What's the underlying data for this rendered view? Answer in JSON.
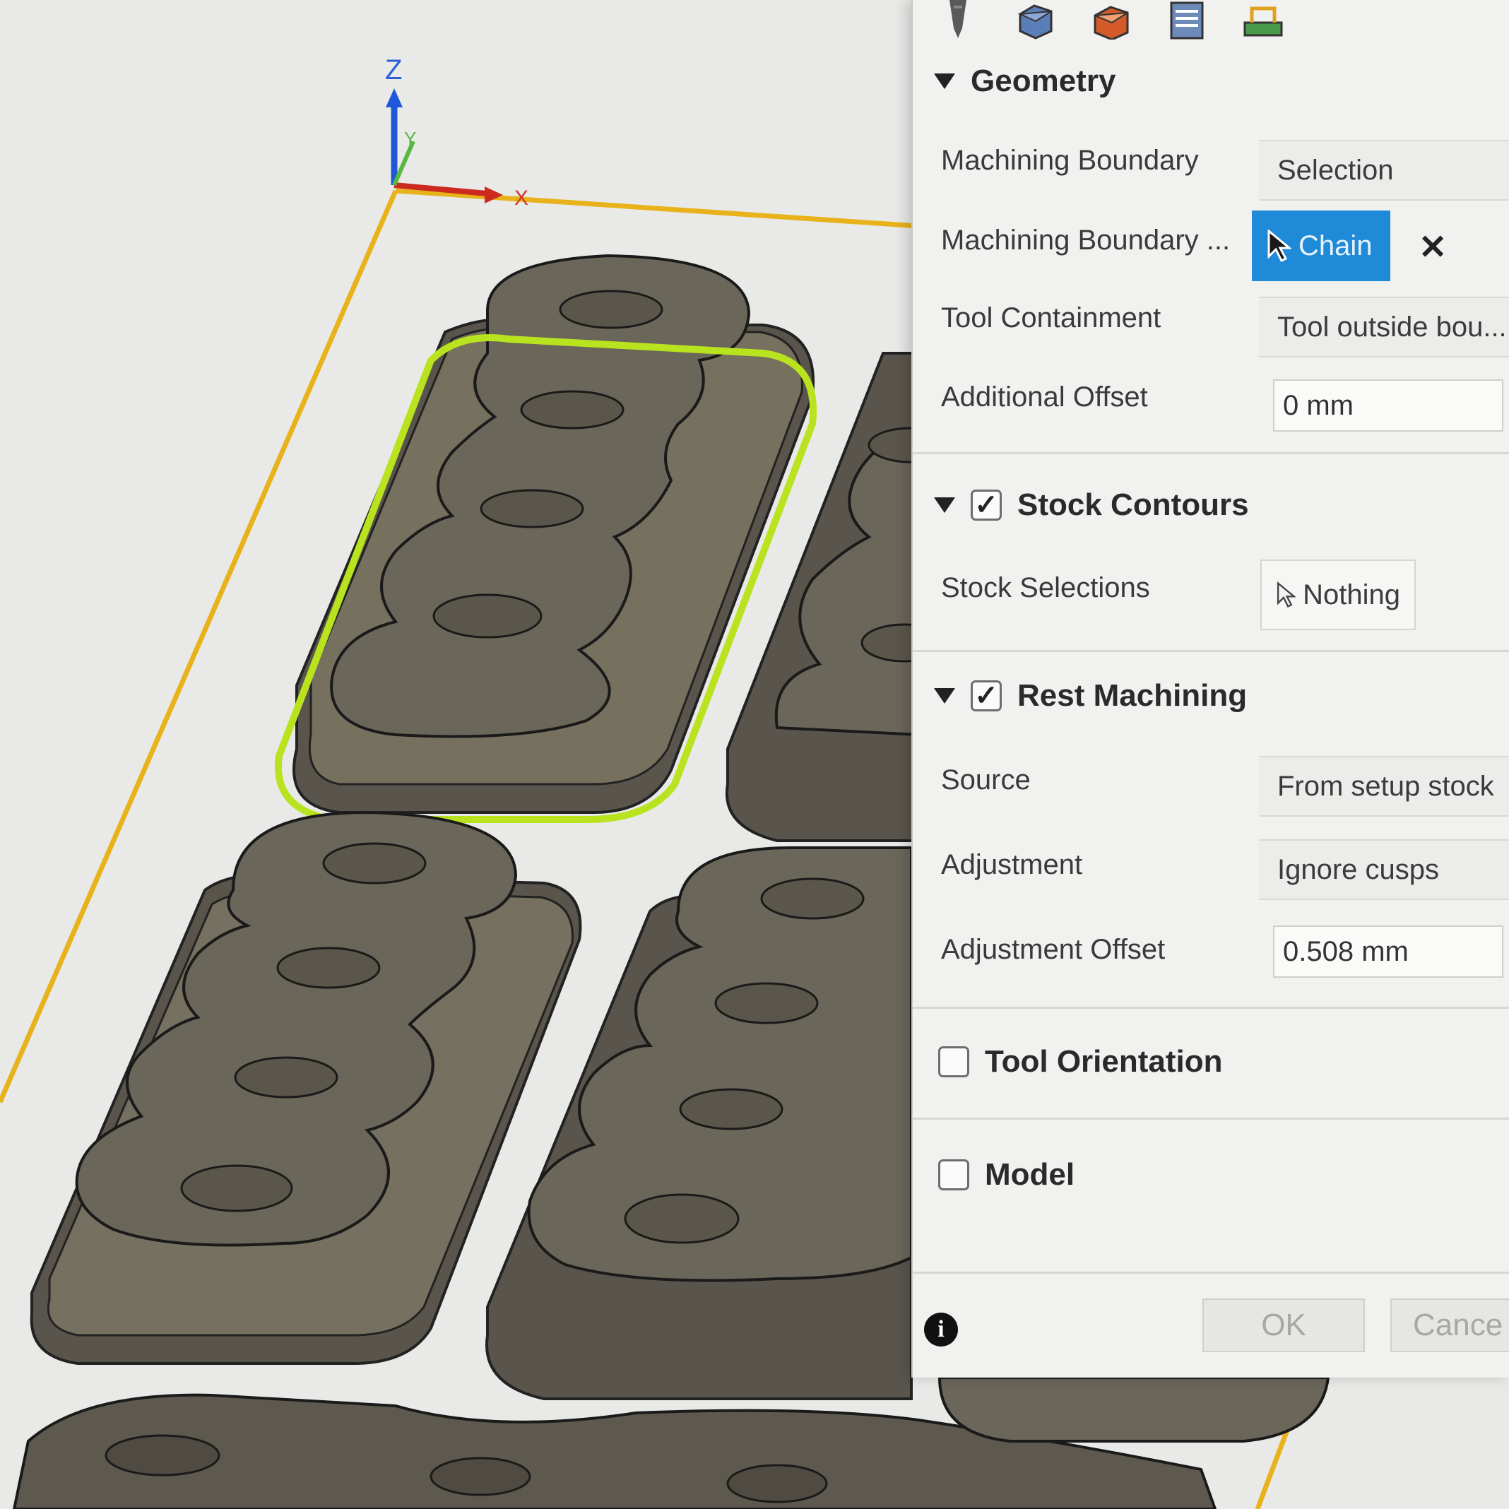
{
  "viewport": {
    "axes": {
      "z_label": "Z",
      "x_label": "X",
      "y_label": "Y"
    },
    "colors": {
      "part": "#6f6a5f",
      "part_dark": "#4a463f",
      "highlight": "#b9e31f",
      "stock_outline": "#e8b21a"
    }
  },
  "toolbar": {
    "tabs": [
      {
        "icon": "tool-icon"
      },
      {
        "icon": "geometry-icon"
      },
      {
        "icon": "heights-icon"
      },
      {
        "icon": "passes-icon"
      },
      {
        "icon": "linking-icon"
      }
    ]
  },
  "geometry": {
    "title": "Geometry",
    "machining_boundary_label": "Machining Boundary",
    "machining_boundary_value": "Selection",
    "machining_boundary_sel_label": "Machining Boundary ...",
    "chain_label": "Chain",
    "tool_containment_label": "Tool Containment",
    "tool_containment_value": "Tool outside bou...",
    "additional_offset_label": "Additional Offset",
    "additional_offset_value": "0 mm"
  },
  "stock_contours": {
    "title": "Stock Contours",
    "checked": true,
    "stock_selections_label": "Stock Selections",
    "stock_selections_value": "Nothing"
  },
  "rest_machining": {
    "title": "Rest Machining",
    "checked": true,
    "source_label": "Source",
    "source_value": "From setup stock",
    "adjustment_label": "Adjustment",
    "adjustment_value": "Ignore cusps",
    "adjustment_offset_label": "Adjustment Offset",
    "adjustment_offset_value": "0.508 mm"
  },
  "tool_orientation": {
    "title": "Tool Orientation",
    "checked": false
  },
  "model": {
    "title": "Model",
    "checked": false
  },
  "footer": {
    "ok_label": "OK",
    "cancel_label": "Cance"
  }
}
